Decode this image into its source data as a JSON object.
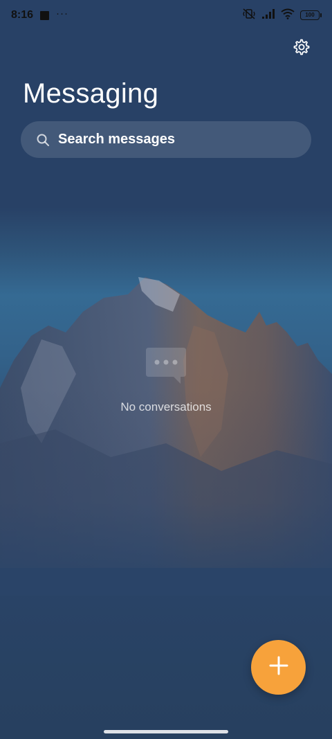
{
  "status_bar": {
    "time": "8:16",
    "overflow_indicator": "···",
    "battery_level": "100",
    "icons": [
      "mute-vibrate-icon",
      "signal-icon",
      "wifi-icon",
      "battery-icon"
    ]
  },
  "header": {
    "title": "Messaging",
    "settings_icon": "gear-icon"
  },
  "search": {
    "placeholder": "Search messages",
    "icon": "search-icon"
  },
  "empty_state": {
    "icon": "chat-bubble-icon",
    "message": "No conversations"
  },
  "fab": {
    "icon": "plus-icon",
    "color": "#f7a23b"
  },
  "theme": {
    "background": "#2a4468",
    "accent": "#f7a23b"
  }
}
